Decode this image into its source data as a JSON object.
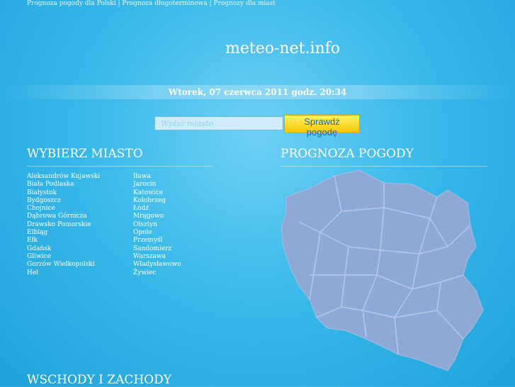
{
  "topnav": {
    "links": [
      "Prognoza pogody dla Polski",
      "Prognoza długoterminowa",
      "Prognozy dla miast"
    ],
    "separator": "|"
  },
  "site_title": "meteo-net.info",
  "date": "Wtorek, 07 czerwca 2011 godz. 20:34",
  "search": {
    "placeholder": "Wpisz miasto",
    "button": "Sprawdź pogodę"
  },
  "sections": {
    "cities_title": "WYBIERZ MIASTO",
    "forecast_title": "PROGNOZA POGODY",
    "sun_title": "WSCHODY I ZACHODY"
  },
  "cities_col1": [
    "Aleksandrów Kujawski",
    "Biała Podlaska",
    "Białystok",
    "Bydgoszcz",
    "Chojnice",
    "Dąbrowa Górnicza",
    "Drawsko Pomorskie",
    "Elbląg",
    "Ełk",
    "Gdańsk",
    "Gliwice",
    "Gorzów Wielkopolski",
    "Hel"
  ],
  "cities_col2": [
    "Iława",
    "Jarocin",
    "Katowice",
    "Kołobrzeg",
    "Łódź",
    "Mrągowo",
    "Olsztyn",
    "Opole",
    "Przemyśl",
    "Sandomierz",
    "Warszawa",
    "Władysławowo",
    "Żywiec"
  ],
  "colors": {
    "map_fill": "#8fa9d6",
    "button": "#f7c500"
  }
}
